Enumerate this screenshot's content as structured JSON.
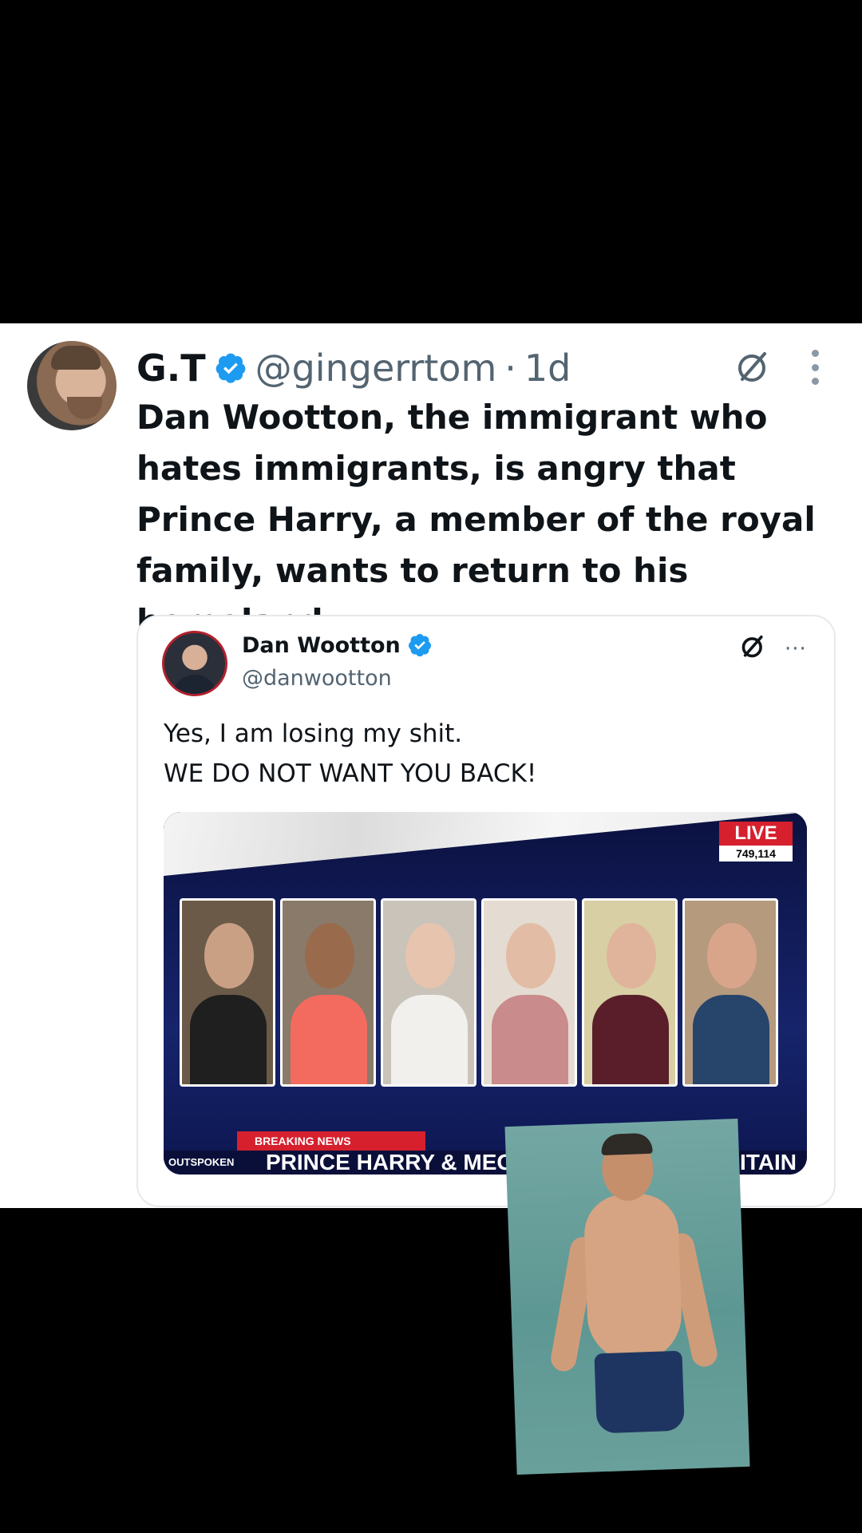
{
  "tweet": {
    "author_name": "G.T",
    "handle": "@gingerrtom",
    "separator": "·",
    "time": "1d",
    "text": "Dan Wootton, the immigrant who hates immigrants, is angry that Prince Harry, a member of the royal family, wants to return to his homeland."
  },
  "quoted_tweet": {
    "author_name": "Dan Wootton",
    "handle": "@danwootton",
    "more": "···",
    "line1": "Yes, I am losing my shit.",
    "line2": "WE DO NOT WANT YOU BACK!",
    "media": {
      "live_label": "LIVE",
      "viewer_count": "749,114",
      "breaking_label": "BREAKING NEWS",
      "brand": "OUTSPOKEN",
      "headline": "PRINCE HARRY & MEGHAN MA",
      "headline_tail": "ITAIN"
    }
  },
  "overlay": {
    "emoji": "😂"
  },
  "colors": {
    "verified": "#1d9bf0",
    "live_red": "#d6202e",
    "background": "#000000",
    "card": "#ffffff"
  },
  "icons": [
    "verified-badge-icon",
    "grok-icon",
    "more-options-icon",
    "tears-of-joy-emoji"
  ]
}
